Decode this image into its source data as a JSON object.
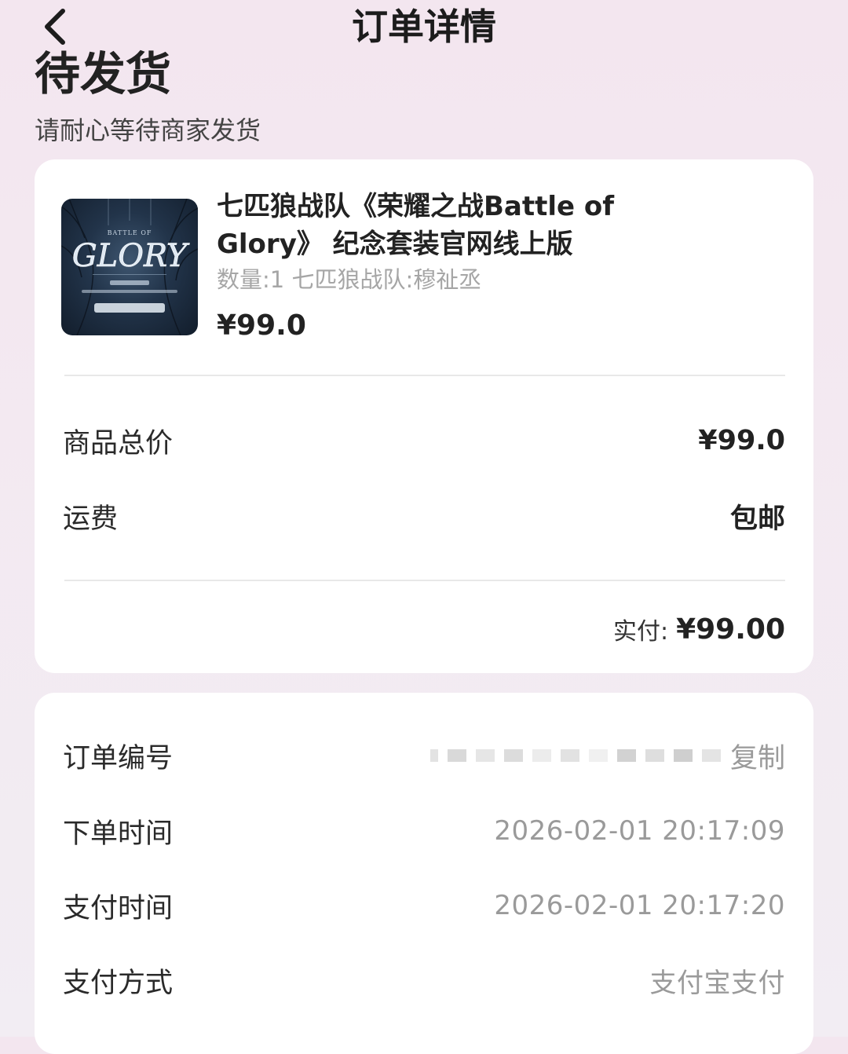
{
  "header": {
    "title": "订单详情",
    "back_icon": "chevron-left-icon"
  },
  "status": {
    "title": "待发货",
    "subtitle": "请耐心等待商家发货"
  },
  "product": {
    "name": "七匹狼战队《荣耀之战Battle of Glory》 纪念套装官网线上版",
    "spec": "数量:1 七匹狼战队:穆祉丞",
    "price": "¥99.0",
    "thumb_label": "GLORY"
  },
  "summary": {
    "goods_total_label": "商品总价",
    "goods_total_value": "¥99.0",
    "shipping_label": "运费",
    "shipping_value": "包邮",
    "paid_label": "实付:",
    "paid_value": "¥99.00"
  },
  "order_info": {
    "order_no_label": "订单编号",
    "order_no_value": "",
    "copy_label": "复制",
    "order_time_label": "下单时间",
    "order_time_value": "2026-02-01 20:17:09",
    "pay_time_label": "支付时间",
    "pay_time_value": "2026-02-01 20:17:20",
    "pay_method_label": "支付方式",
    "pay_method_value": "支付宝支付"
  },
  "colors": {
    "background": "#f3e8f0",
    "card": "#ffffff",
    "text_primary": "#222222",
    "text_secondary": "#9a9a9a"
  }
}
